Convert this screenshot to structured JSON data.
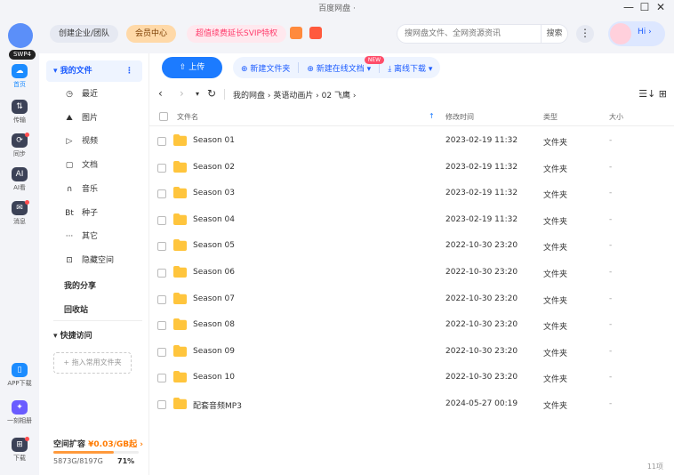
{
  "window": {
    "title": "百度网盘 ·",
    "controls": [
      "—",
      "☐",
      "✕"
    ]
  },
  "rail": {
    "badge": "SWP4",
    "items": [
      {
        "icon": "☁",
        "label": "首页"
      },
      {
        "icon": "⇅",
        "label": "传输"
      },
      {
        "icon": "⟳",
        "label": "同步"
      },
      {
        "icon": "AI",
        "label": "AI看"
      },
      {
        "icon": "✉",
        "label": "消息"
      },
      {
        "icon": "▯",
        "label": "APP下载"
      },
      {
        "icon": "✦",
        "label": "一刻相册"
      },
      {
        "icon": "⊞",
        "label": "下载"
      }
    ]
  },
  "topbar": {
    "enterprise": "创建企业/团队",
    "member": "会员中心",
    "promo": "超值续费延长SVIP特权",
    "search_placeholder": "搜网盘文件、全网资源资讯",
    "search_button": "搜索",
    "menu": "⋮",
    "greeting": "Hi ›"
  },
  "nav": {
    "my_files": "▾  我的文件",
    "more": "⋮",
    "categories": [
      {
        "icon": "◷",
        "label": "最近"
      },
      {
        "icon": "⛰",
        "label": "图片"
      },
      {
        "icon": "▷",
        "label": "视频"
      },
      {
        "icon": "▢",
        "label": "文档"
      },
      {
        "icon": "∩",
        "label": "音乐"
      },
      {
        "icon": "Bt",
        "label": "种子"
      },
      {
        "icon": "···",
        "label": "其它"
      },
      {
        "icon": "⊡",
        "label": "隐藏空间"
      }
    ],
    "my_share": "我的分享",
    "recycle": "回收站",
    "quick_access": "▾  快捷访问",
    "pin_button": "+ 拖入常用文件夹"
  },
  "storage": {
    "label": "空间扩容",
    "price": "¥0.03/GB起 ›",
    "used": "5873G/8197G",
    "percent": "71%",
    "fraction": 0.71
  },
  "toolbar": {
    "upload": "⇧ 上传",
    "new_folder": "⊕ 新建文件夹",
    "new_online_doc": "⊕ 新建在线文档 ▾",
    "new_badge": "NEW",
    "offline_download": "⤓ 离线下载 ▾"
  },
  "path": {
    "back": "‹",
    "forward": "›",
    "dropdown": "▾",
    "refresh": "↻",
    "crumbs": "我的网盘  ›  英语动画片  ›  02 飞鹰  ›",
    "view_icons": "☰↓  ⊞"
  },
  "table": {
    "headers": {
      "name": "文件名",
      "sort": "↑",
      "modified": "修改时间",
      "type": "类型",
      "size": "大小"
    },
    "rows": [
      {
        "name": "Season 01",
        "date": "2023-02-19 11:32",
        "type": "文件夹",
        "size": "-"
      },
      {
        "name": "Season 02",
        "date": "2023-02-19 11:32",
        "type": "文件夹",
        "size": "-"
      },
      {
        "name": "Season 03",
        "date": "2023-02-19 11:32",
        "type": "文件夹",
        "size": "-"
      },
      {
        "name": "Season 04",
        "date": "2023-02-19 11:32",
        "type": "文件夹",
        "size": "-"
      },
      {
        "name": "Season 05",
        "date": "2022-10-30 23:20",
        "type": "文件夹",
        "size": "-"
      },
      {
        "name": "Season 06",
        "date": "2022-10-30 23:20",
        "type": "文件夹",
        "size": "-"
      },
      {
        "name": "Season 07",
        "date": "2022-10-30 23:20",
        "type": "文件夹",
        "size": "-"
      },
      {
        "name": "Season 08",
        "date": "2022-10-30 23:20",
        "type": "文件夹",
        "size": "-"
      },
      {
        "name": "Season 09",
        "date": "2022-10-30 23:20",
        "type": "文件夹",
        "size": "-"
      },
      {
        "name": "Season 10",
        "date": "2022-10-30 23:20",
        "type": "文件夹",
        "size": "-"
      },
      {
        "name": "配套音频MP3",
        "date": "2024-05-27 00:19",
        "type": "文件夹",
        "size": "-"
      }
    ],
    "count": "11项"
  },
  "colors": {
    "accent": "#1c7bff",
    "folder": "#ffc53d",
    "member_bg": "#ffd9a8",
    "promo_text": "#ff3b6b"
  }
}
